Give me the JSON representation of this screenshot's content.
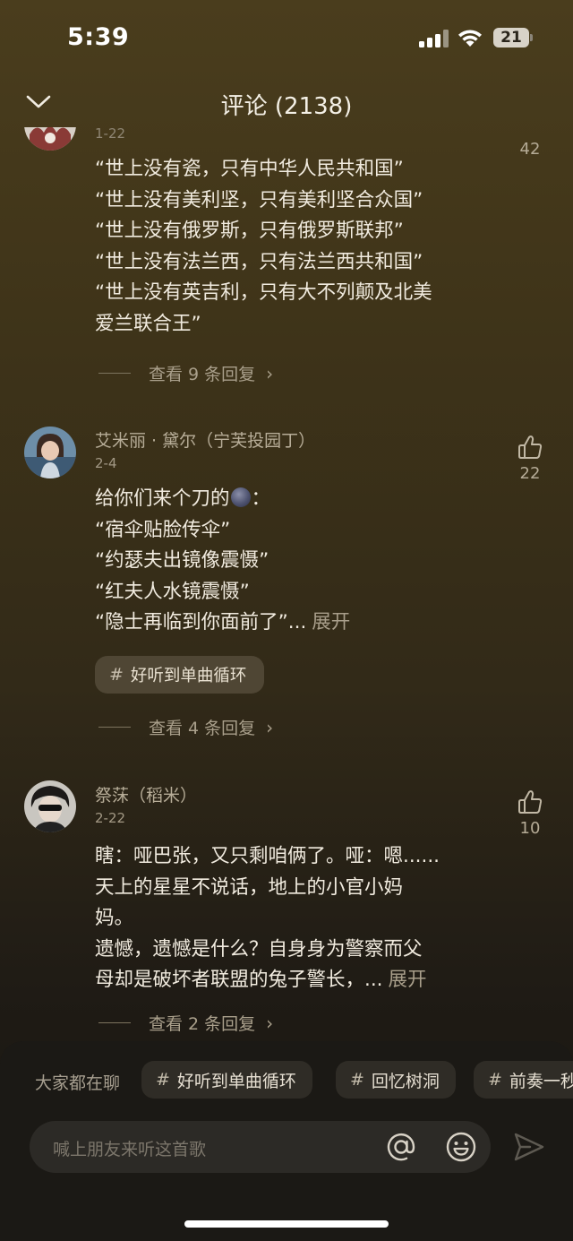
{
  "status_bar": {
    "time": "5:39",
    "battery": "21"
  },
  "header": {
    "title": "评论 (2138)"
  },
  "comments": [
    {
      "date": "1-22",
      "likes": "42",
      "lines": [
        "“世上没有瓷，只有中华人民共和国”",
        "“世上没有美利坚，只有美利坚合众国”",
        "“世上没有俄罗斯，只有俄罗斯联邦”",
        "“世上没有法兰西，只有法兰西共和国”",
        "“世上没有英吉利，只有大不列颠及北美",
        "爱兰联合王”"
      ],
      "replies": "查看 9 条回复"
    },
    {
      "user": "艾米丽 · 黛尔（宁芙投园丁）",
      "date": "2-4",
      "likes": "22",
      "line_first_a": "给你们来个刀的",
      "line_first_b": "：",
      "lines": [
        "“宿伞贴脸传伞”",
        "“约瑟夫出镜像震慑”",
        "“红夫人水镜震慑”"
      ],
      "line_last": "“隐士再临到你面前了”...",
      "expand": "展开",
      "tag": "好听到单曲循环",
      "replies": "查看 4 条回复"
    },
    {
      "user": "祭莯（稻米）",
      "date": "2-22",
      "likes": "10",
      "lines": [
        "瞎：哑巴张，又只剩咱俩了。哑：嗯......",
        "天上的星星不说话，地上的小官小妈",
        "妈。",
        "遗憾，遗憾是什么？自身身为警察而父"
      ],
      "line_last": "母却是破坏者联盟的兔子警长，...",
      "expand": "展开",
      "replies": "查看 2 条回复"
    }
  ],
  "bottom": {
    "topics_label": "大家都在聊",
    "topics": [
      "好听到单曲循环",
      "回忆树洞",
      "前奏一秒"
    ],
    "hash": "#",
    "input_placeholder": "喊上朋友来听这首歌"
  },
  "icons": {
    "back": "chevron-down-icon",
    "like": "thumb-up-icon",
    "replies_more": "chevron-right-icon",
    "at": "at-icon",
    "emoji": "smile-icon",
    "send": "send-icon"
  },
  "colors": {
    "background_top": "#4a3d1d",
    "background_bottom": "#17150f",
    "panel": "#1b1915",
    "chip": "#4f4634"
  }
}
